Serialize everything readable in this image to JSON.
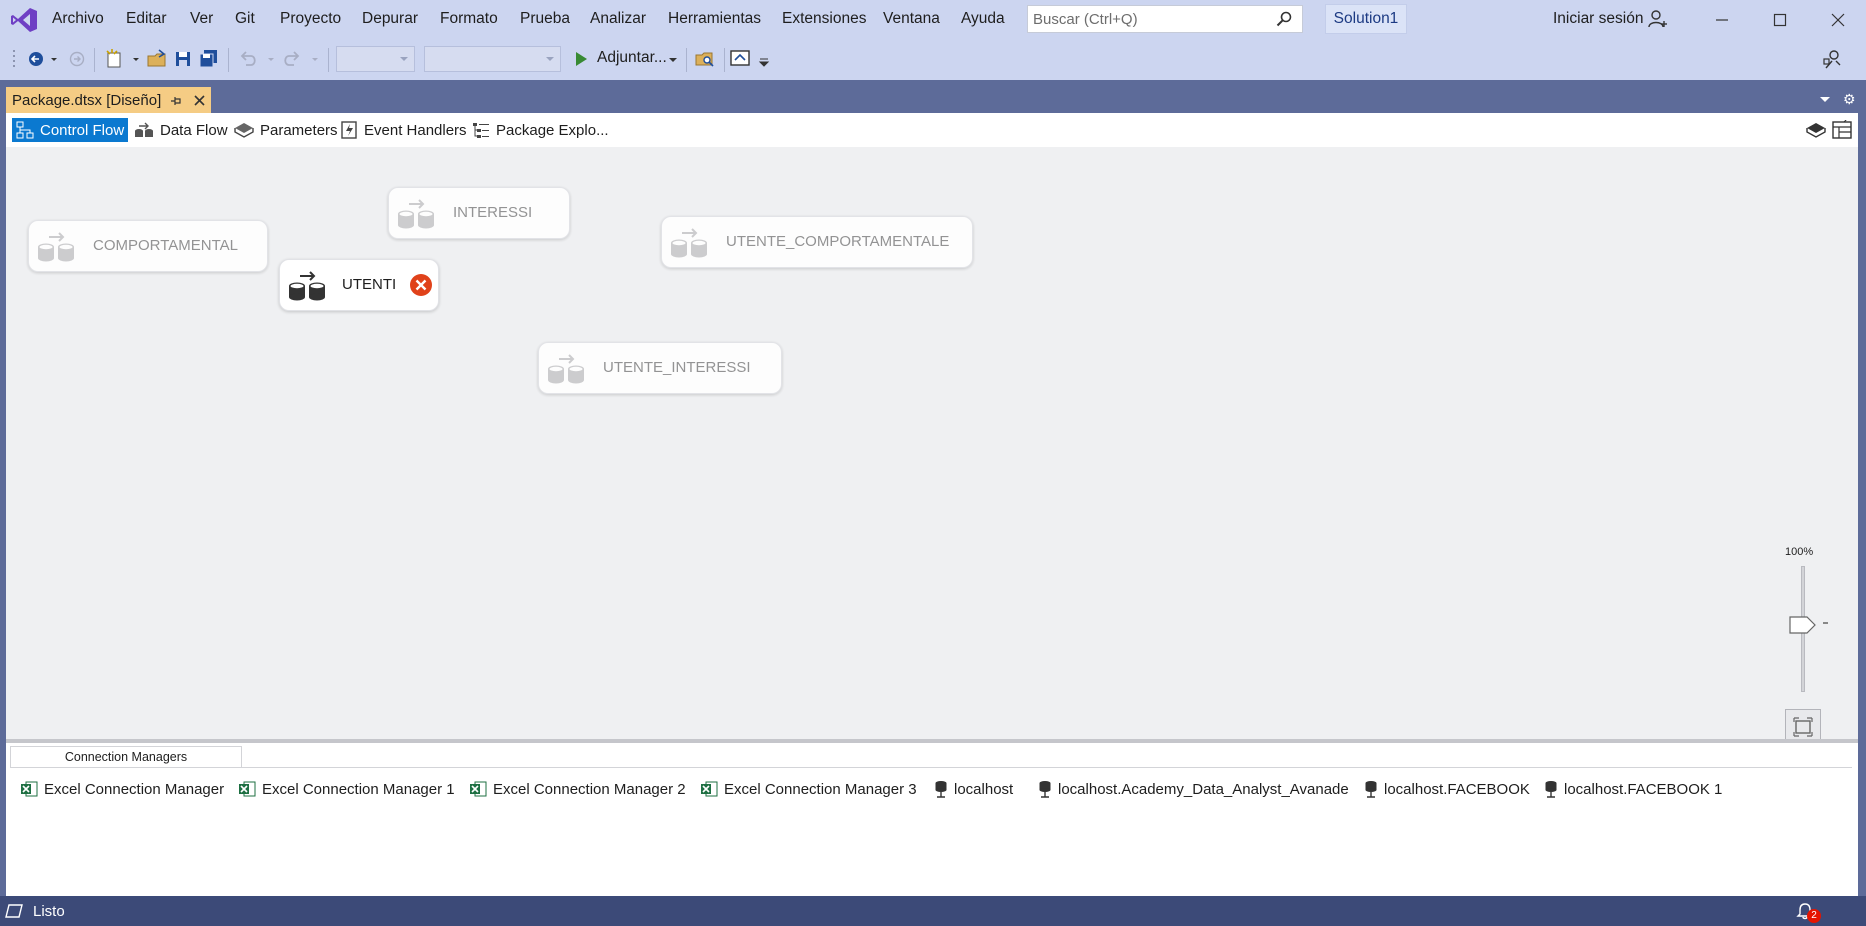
{
  "app": {
    "solution_name": "Solution1",
    "signin_label": "Iniciar sesión"
  },
  "menu": {
    "items": [
      "Archivo",
      "Editar",
      "Ver",
      "Git",
      "Proyecto",
      "Depurar",
      "Formato",
      "Prueba",
      "Analizar",
      "Herramientas",
      "Extensiones",
      "Ventana",
      "Ayuda"
    ]
  },
  "search": {
    "placeholder": "Buscar (Ctrl+Q)"
  },
  "toolbar": {
    "attach_label": "Adjuntar..."
  },
  "document_tab": {
    "label": "Package.dtsx [Diseño]"
  },
  "designer_tabs": [
    "Control Flow",
    "Data Flow",
    "Parameters",
    "Event Handlers",
    "Package Explo..."
  ],
  "tasks": [
    {
      "label": "COMPORTAMENTAL",
      "state": "disabled"
    },
    {
      "label": "INTERESSI",
      "state": "disabled"
    },
    {
      "label": "UTENTI",
      "state": "error"
    },
    {
      "label": "UTENTE_COMPORTAMENTALE",
      "state": "disabled"
    },
    {
      "label": "UTENTE_INTERESSI",
      "state": "disabled"
    }
  ],
  "zoom": {
    "label": "100%"
  },
  "connection_managers": {
    "tab_label": "Connection Managers",
    "items": [
      {
        "label": "Excel Connection Manager",
        "icon": "excel-icon"
      },
      {
        "label": "Excel Connection Manager 1",
        "icon": "excel-icon"
      },
      {
        "label": "Excel Connection Manager 2",
        "icon": "excel-icon"
      },
      {
        "label": "Excel Connection Manager 3",
        "icon": "excel-icon"
      },
      {
        "label": "localhost",
        "icon": "database-connection-icon"
      },
      {
        "label": "localhost.Academy_Data_Analyst_Avanade",
        "icon": "database-connection-icon"
      },
      {
        "label": "localhost.FACEBOOK",
        "icon": "database-connection-icon"
      },
      {
        "label": "localhost.FACEBOOK 1",
        "icon": "database-connection-icon"
      }
    ]
  },
  "status": {
    "text": "Listo",
    "notifications": "2"
  },
  "colors": {
    "accent": "#0b79d0",
    "error": "#e0421a",
    "chrome": "#ccd5f0",
    "statusbar": "#3c4a78",
    "tab_active": "#f5cc84"
  }
}
